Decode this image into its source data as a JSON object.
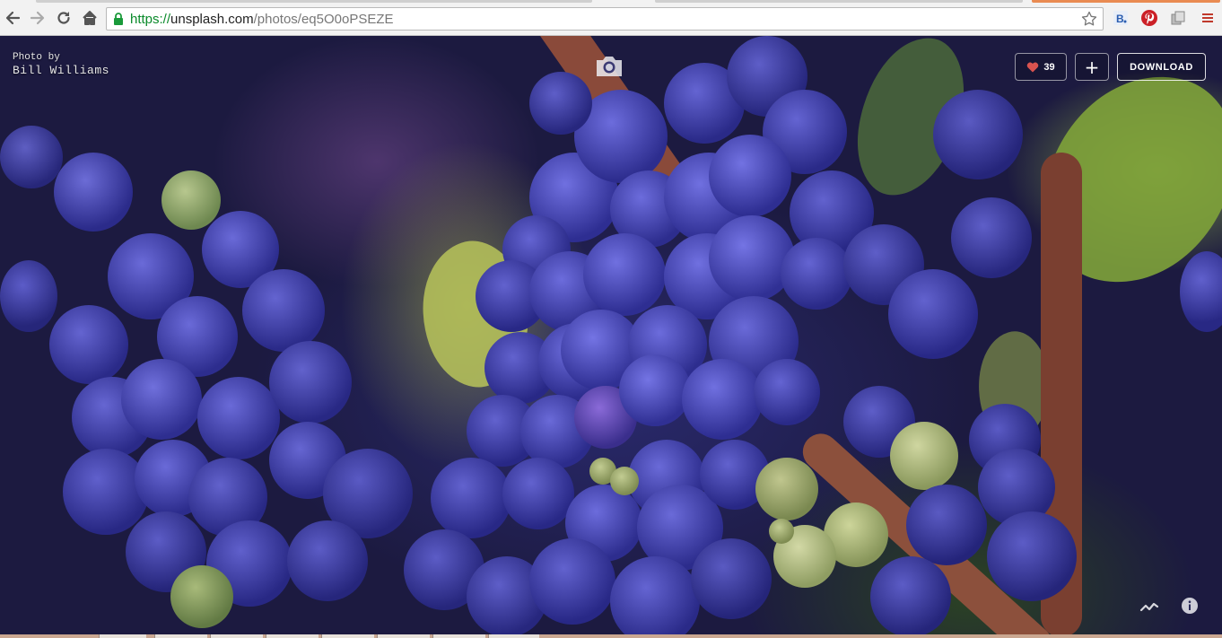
{
  "browser": {
    "url_scheme": "https://",
    "url_host": "unsplash.com",
    "url_path": "/photos/eq5O0oPSEZE",
    "extensions": [
      "bookmark-extension-icon",
      "pinterest-icon",
      "copy-extension-icon",
      "menu-icon"
    ],
    "extension_colors": {
      "pinterest": "#cb2027",
      "menu": "#c0392b"
    }
  },
  "photo": {
    "credit_prefix": "Photo by",
    "photographer": "Bill Williams"
  },
  "actions": {
    "like_count": "39",
    "add_label": "+",
    "download_label": "DOWNLOAD"
  },
  "colors": {
    "accent_secure": "#0a8a2a",
    "heart": "#d9534f"
  }
}
